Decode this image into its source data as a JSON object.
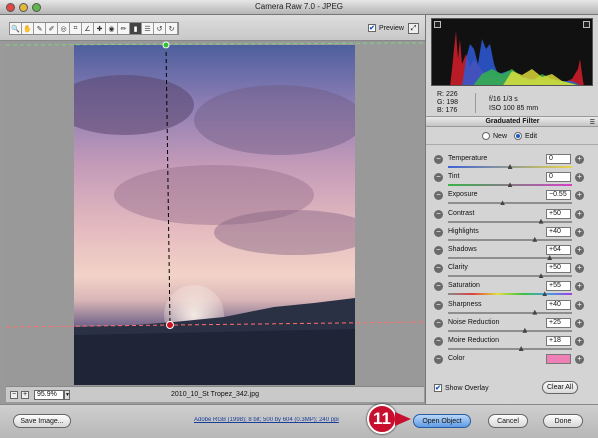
{
  "window": {
    "title": "Camera Raw 7.0  -  JPEG"
  },
  "toolbar": {
    "tools": [
      {
        "name": "zoom-tool",
        "glyph": "🔍"
      },
      {
        "name": "hand-tool",
        "glyph": "✋"
      },
      {
        "name": "white-balance-tool",
        "glyph": "✎"
      },
      {
        "name": "color-sampler-tool",
        "glyph": "✐"
      },
      {
        "name": "targeted-adjustment-tool",
        "glyph": "◎"
      },
      {
        "name": "crop-tool",
        "glyph": "⌗"
      },
      {
        "name": "straighten-tool",
        "glyph": "∠"
      },
      {
        "name": "spot-removal-tool",
        "glyph": "✚"
      },
      {
        "name": "red-eye-tool",
        "glyph": "◉"
      },
      {
        "name": "adjustment-brush-tool",
        "glyph": "✏"
      },
      {
        "name": "graduated-filter-tool",
        "glyph": "▮"
      },
      {
        "name": "preferences-tool",
        "glyph": "☰"
      },
      {
        "name": "rotate-left-tool",
        "glyph": "↺"
      },
      {
        "name": "rotate-right-tool",
        "glyph": "↻"
      }
    ],
    "active_tool_index": 10,
    "preview_label": "Preview",
    "preview_checked": true
  },
  "canvas": {
    "zoom_value": "95.9%",
    "filename": "2010_10_St Tropez_342.jpg"
  },
  "info": {
    "r": "R:  226",
    "g": "G:  198",
    "b": "B:  176",
    "exposure_line": "f/16    1/3 s",
    "iso_line": "ISO 100   85 mm"
  },
  "panel": {
    "title": "Graduated Filter",
    "mode_new": "New",
    "mode_edit": "Edit",
    "selected_mode": "edit",
    "sliders": [
      {
        "label": "Temperature",
        "value": "0",
        "pos": 0.5,
        "track": "temp"
      },
      {
        "label": "Tint",
        "value": "0",
        "pos": 0.5,
        "track": "tint"
      },
      {
        "label": "Exposure",
        "value": "−0.55",
        "pos": 0.44
      },
      {
        "label": "Contrast",
        "value": "+50",
        "pos": 0.75
      },
      {
        "label": "Highlights",
        "value": "+40",
        "pos": 0.7
      },
      {
        "label": "Shadows",
        "value": "+64",
        "pos": 0.82
      },
      {
        "label": "Clarity",
        "value": "+50",
        "pos": 0.75
      },
      {
        "label": "Saturation",
        "value": "+55",
        "pos": 0.78,
        "track": "sat"
      },
      {
        "label": "Sharpness",
        "value": "+40",
        "pos": 0.7
      },
      {
        "label": "Noise Reduction",
        "value": "+25",
        "pos": 0.62
      },
      {
        "label": "Moire Reduction",
        "value": "+18",
        "pos": 0.59
      }
    ],
    "color_label": "Color",
    "color_swatch": "#ee7fb7",
    "show_overlay_label": "Show Overlay",
    "show_overlay_checked": true,
    "clear_all_label": "Clear All"
  },
  "footer": {
    "save_label": "Save Image...",
    "workflow_link": "Adobe RGB (1998); 8 bit; 500 by 604 (0.3MP); 240 ppi",
    "open_label": "Open Object",
    "cancel_label": "Cancel",
    "done_label": "Done",
    "callout_number": "11"
  }
}
